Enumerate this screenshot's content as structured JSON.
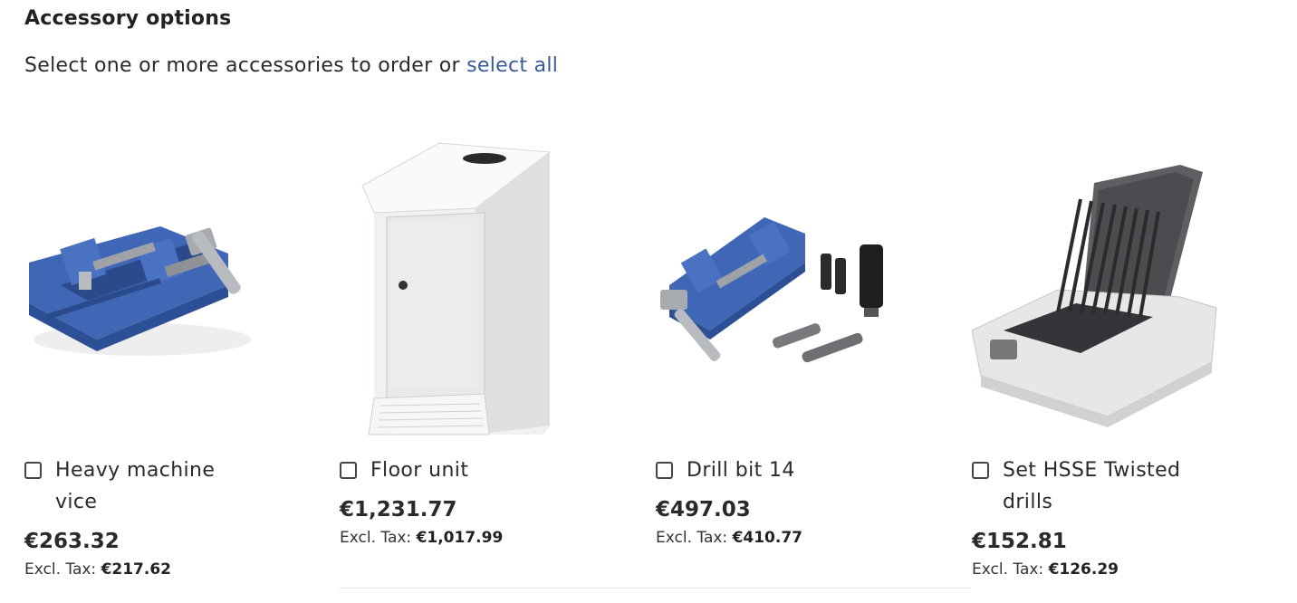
{
  "section": {
    "title": "Accessory options",
    "intro_text": "Select one or more accessories to order or",
    "select_all_label": "select all"
  },
  "tax_label": "Excl. Tax:",
  "colors": {
    "link": "#3b5998",
    "vice_blue": "#3f67b5",
    "text": "#222222"
  },
  "products": [
    {
      "name": "Heavy machine vice",
      "price": "€263.32",
      "price_excl_tax": "€217.62",
      "image_icon": "machine-vice-image",
      "checked": false
    },
    {
      "name": "Floor unit",
      "price": "€1,231.77",
      "price_excl_tax": "€1,017.99",
      "image_icon": "floor-cabinet-image",
      "checked": false
    },
    {
      "name": "Drill bit 14",
      "price": "€497.03",
      "price_excl_tax": "€410.77",
      "image_icon": "drill-vice-kit-image",
      "checked": false
    },
    {
      "name": "Set HSSE Twisted drills",
      "price": "€152.81",
      "price_excl_tax": "€126.29",
      "image_icon": "drill-bit-case-image",
      "checked": false
    }
  ]
}
